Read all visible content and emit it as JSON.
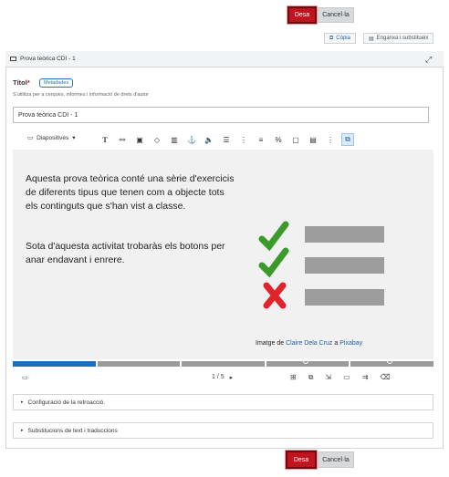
{
  "top_actions": {
    "save": "Desa",
    "cancel": "Cancel·la"
  },
  "sub_actions": {
    "copy": "Còpia",
    "paste_replace": "Enganxa i substitueix"
  },
  "card": {
    "title": "Prova teòrica CDI - 1"
  },
  "title_field": {
    "label": "Títol",
    "required_mark": "*",
    "meta_badge": "Metadades",
    "help": "S'utilitza per a cerques, informes i informació de drets d'autor",
    "value": "Prova teòrica CDI - 1"
  },
  "toolbar": {
    "slides_label": "Diapositives"
  },
  "slide": {
    "paragraph1": "Aquesta prova teòrica conté una sèrie d'exercicis de diferents tipus que tenen com a objecte tots els continguts que s'han vist a classe.",
    "paragraph2": "Sota d'aquesta activitat trobaràs els botons per anar endavant i enrere.",
    "credit_prefix": "Imatge de ",
    "credit_author": "Claire Dela Cruz",
    "credit_middle": " a ",
    "credit_site": "Pixabay"
  },
  "pager": {
    "text": "1 / 5"
  },
  "accordions": {
    "feedback": "Configuració de la retroacció.",
    "substitutions": "Substitucions de text i traduccions"
  },
  "bottom_actions": {
    "save": "Desa",
    "cancel": "Cancel·la"
  },
  "colors": {
    "accent": "#c0151f",
    "link": "#1f5fa4",
    "progress": "#1f6fbe",
    "check": "#3a9a2a",
    "cross": "#e0242c"
  }
}
